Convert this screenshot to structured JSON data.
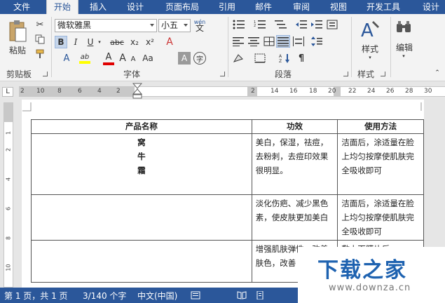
{
  "tabs": {
    "file": "文件",
    "items": [
      "开始",
      "插入",
      "设计",
      "页面布局",
      "引用",
      "邮件",
      "审阅",
      "视图",
      "开发工具",
      "设计"
    ]
  },
  "ribbon": {
    "clipboard": {
      "label": "剪贴板",
      "paste": "粘贴"
    },
    "font": {
      "label": "字体",
      "font_name": "微软雅黑",
      "font_size": "小五",
      "wen": "wén",
      "wen_char": "文",
      "bold": "B",
      "italic": "I",
      "underline": "U",
      "strike": "abc",
      "sub": "x₂",
      "sup": "x²",
      "grow": "A",
      "shrink": "A",
      "aa": "Aa",
      "font_color": "A",
      "highlight": "ab",
      "char_shade": "A",
      "enclose": "字"
    },
    "paragraph": {
      "label": "段落"
    },
    "styles": {
      "label": "样式",
      "button": "样式"
    },
    "editing": {
      "button": "编辑"
    }
  },
  "ruler": {
    "tab_stop": "L",
    "numbers": [
      "2",
      "10",
      "8",
      "6",
      "4",
      "2",
      "2",
      "14",
      "16",
      "18",
      "20",
      "22",
      "24",
      "26",
      "28",
      "30"
    ]
  },
  "vruler": {
    "numbers": [
      "1",
      "2",
      "4",
      "6",
      "8",
      "10"
    ]
  },
  "table": {
    "headers": [
      "产品名称",
      "功效",
      "使用方法"
    ],
    "rows": [
      {
        "name": [
          "窝",
          "牛",
          "霜"
        ],
        "effect": "美白，保湿，祛痘，去粉刺，去痘印效果很明显。",
        "usage": "洁面后，涂适量在脸上均匀按摩使肌肤完全吸收即可"
      },
      {
        "name": [],
        "effect": "淡化伤疤、减少黑色素，使皮肤更加美白",
        "usage": "洁面后，涂适量在脸上均匀按摩使肌肤完全吸收即可"
      },
      {
        "name": [],
        "effect": "增强肌肤弹性，改善肤色，改善",
        "usage": "敷上面膜片后"
      }
    ]
  },
  "status": {
    "page": "第 1 页，共 1 页",
    "words": "3/140 个字",
    "lang": "中文(中国)"
  },
  "watermark": {
    "title": "下载之家",
    "url": "www.downza.cn"
  },
  "colors": {
    "accent": "#2b579a",
    "highlight": "#ffff00",
    "font_red": "#e00000"
  }
}
